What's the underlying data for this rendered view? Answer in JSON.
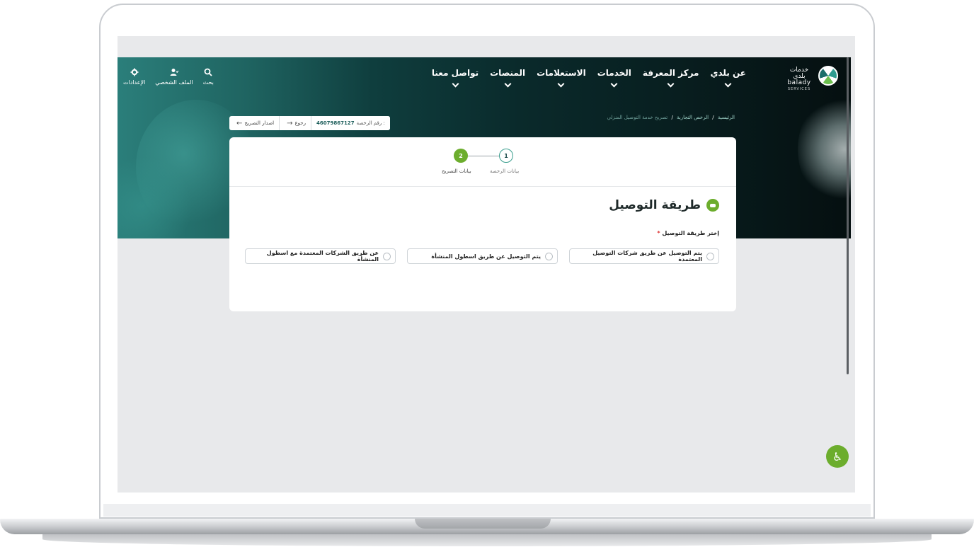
{
  "nav": {
    "logo": {
      "arabic": "خدمات بلدي",
      "english": "balady",
      "services": "SERVICES"
    },
    "menu": [
      {
        "label": "عن بلدي"
      },
      {
        "label": "مركز المعرفة"
      },
      {
        "label": "الخدمات"
      },
      {
        "label": "الاستعلامات"
      },
      {
        "label": "المنصات"
      },
      {
        "label": "تواصل معنا"
      }
    ],
    "tools": [
      {
        "label": "بحث",
        "icon": "search-icon"
      },
      {
        "label": "الملف الشخصي",
        "icon": "user-icon"
      },
      {
        "label": "الإعدادات",
        "icon": "gear-icon"
      }
    ]
  },
  "breadcrumb": {
    "home": "الرئيسية",
    "sep": "/",
    "section": "الرخص التجارية",
    "current": "تصريح خدمة التوصيل المنزلي"
  },
  "actions": {
    "license_label": "رقم الرخصة :",
    "license_number": "46079867127",
    "back_label": "رجوع",
    "issue_label": "اصدار التصريح"
  },
  "steps": [
    {
      "number": "1",
      "label": "بيانات الرخصة"
    },
    {
      "number": "2",
      "label": "بيانات التصريح"
    }
  ],
  "section": {
    "title": "طريقة التوصيل",
    "field_label": "إختر طريقة التوصيل",
    "required_mark": "*",
    "options": [
      "يتم التوصيل عن طريق شركات التوصيل المعتمدة",
      "يتم التوصيل عن طريق اسطول المنشأة",
      "عن طريق الشركات المعتمدة مع اسطول المنشأة"
    ]
  },
  "colors": {
    "accent": "#6cad2d",
    "header_dark": "#081f20",
    "teal": "#2b7f7b"
  },
  "fab": {
    "icon": "accessibility-icon"
  }
}
